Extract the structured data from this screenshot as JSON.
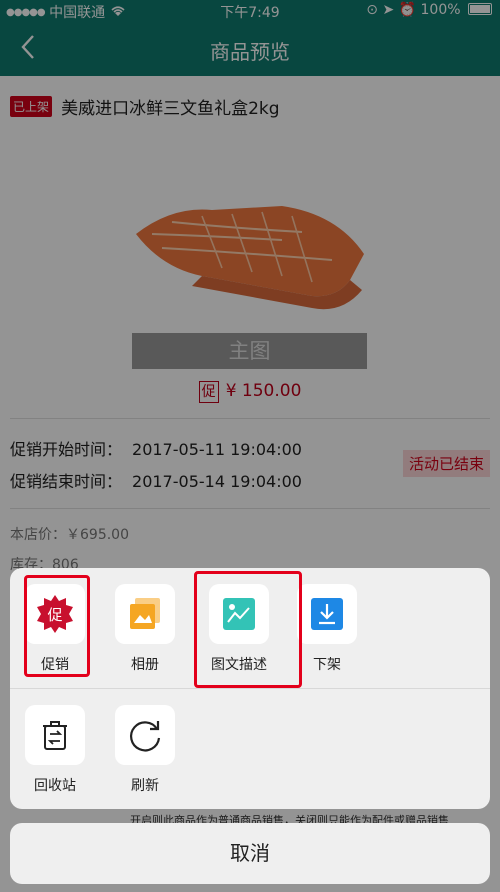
{
  "status_bar": {
    "carrier": "中国联通",
    "time": "下午7:49",
    "battery": "100%"
  },
  "nav": {
    "title": "商品预览"
  },
  "product": {
    "status_tag": "已上架",
    "name": "美威进口冰鲜三文鱼礼盒2kg",
    "image_label": "主图",
    "promo_tag": "促",
    "promo_price": "¥ 150.00",
    "promo_start_label": "促销开始时间：",
    "promo_start_value": "2017-05-11 19:04:00",
    "promo_end_label": "促销结束时间：",
    "promo_end_value": "2017-05-14 19:04:00",
    "promo_status": "活动已结束",
    "store_price": "本店价：￥695.00",
    "stock": "库存：806",
    "footnote": "开启则此商品作为普通商品销售，关闭则只能作为配件或赠品销售"
  },
  "action_sheet": {
    "row1": [
      {
        "label": "促销",
        "icon": "promotion-badge-icon",
        "icon_text": "促"
      },
      {
        "label": "相册",
        "icon": "album-icon"
      },
      {
        "label": "图文描述",
        "icon": "image-description-icon"
      },
      {
        "label": "下架",
        "icon": "take-down-icon"
      }
    ],
    "row2": [
      {
        "label": "回收站",
        "icon": "recycle-bin-icon"
      },
      {
        "label": "刷新",
        "icon": "refresh-icon"
      }
    ],
    "cancel": "取消"
  },
  "colors": {
    "brand": "#0f7a6e",
    "accent_red": "#d0021b",
    "album_orange": "#f5a623",
    "desc_teal": "#33c3b6",
    "download_blue": "#1e88e5"
  }
}
